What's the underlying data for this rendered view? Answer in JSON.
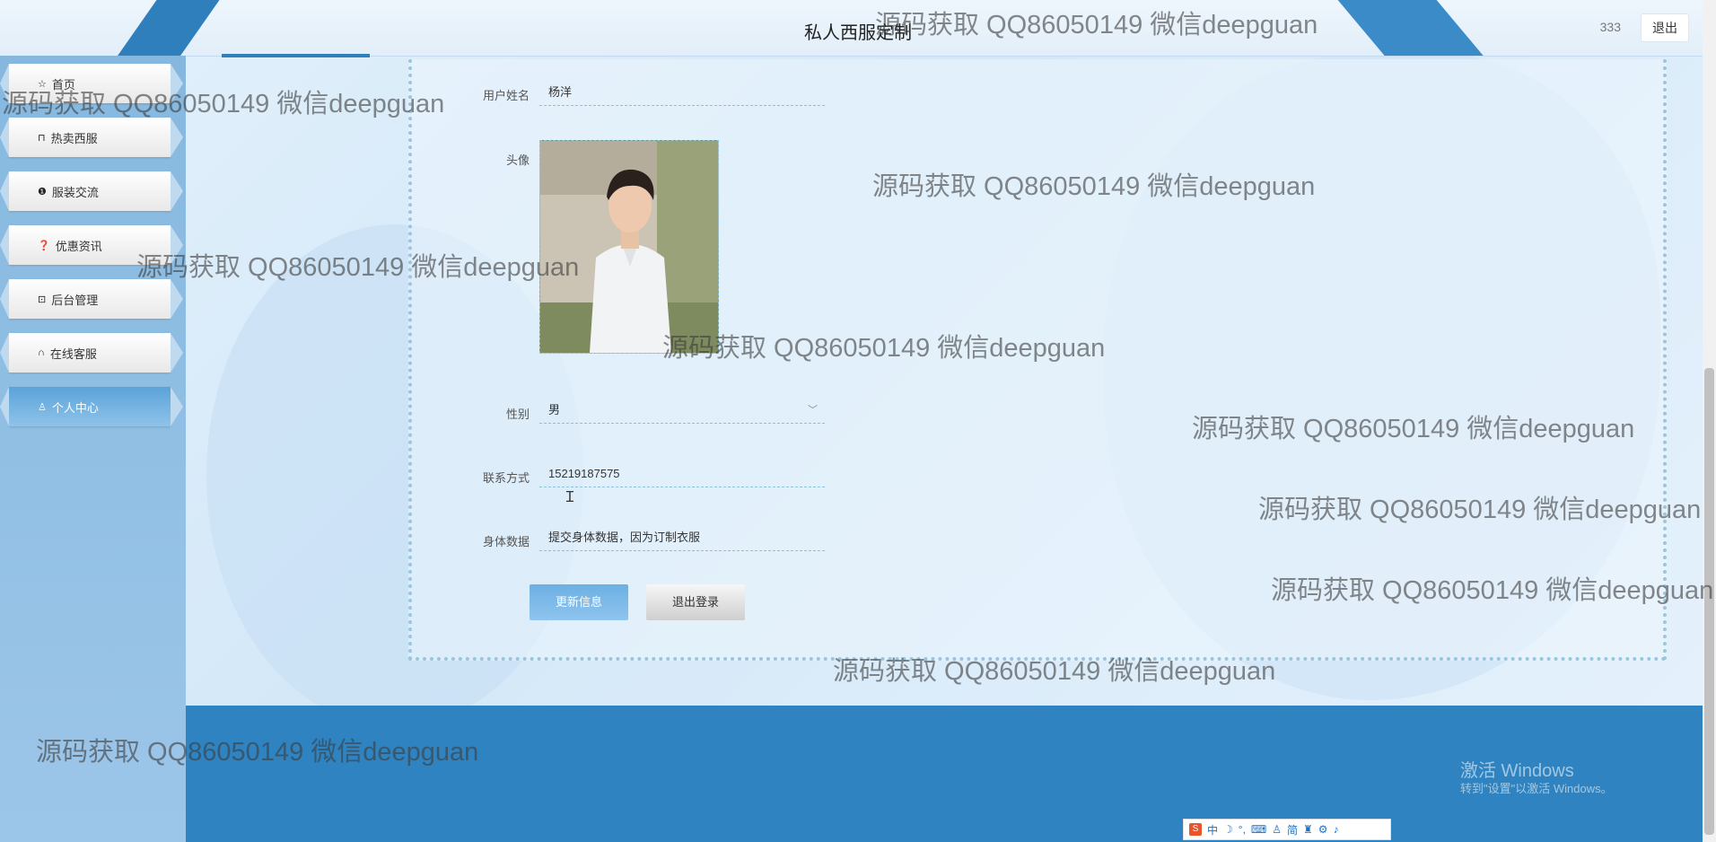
{
  "header": {
    "site_title": "私人西服定制",
    "username": "333",
    "logout_label": "退出"
  },
  "sidebar": {
    "items": [
      {
        "label": "首页",
        "icon": "star-icon"
      },
      {
        "label": "热卖西服",
        "icon": "bag-icon"
      },
      {
        "label": "服装交流",
        "icon": "alert-circle-icon"
      },
      {
        "label": "优惠资讯",
        "icon": "question-circle-icon"
      },
      {
        "label": "后台管理",
        "icon": "briefcase-icon"
      },
      {
        "label": "在线客服",
        "icon": "headset-icon"
      },
      {
        "label": "个人中心",
        "icon": "user-icon",
        "active": true
      }
    ]
  },
  "form": {
    "username_label": "用户姓名",
    "username_value": "杨洋",
    "avatar_label": "头像",
    "gender_label": "性别",
    "gender_value": "男",
    "phone_label": "联系方式",
    "phone_value": "15219187575",
    "body_label": "身体数据",
    "body_value": "提交身体数据，因为订制衣服",
    "update_button": "更新信息",
    "logout_button": "退出登录"
  },
  "watermark_text": "源码获取 QQ86050149 微信deepguan",
  "windows_activation": {
    "title": "激活 Windows",
    "subtitle": "转到\"设置\"以激活 Windows。"
  },
  "ime_toolbar": {
    "items": [
      "中",
      "简"
    ]
  },
  "colors": {
    "accent": "#2f83c0",
    "sidebar": "#8fbfe4",
    "active_nav": "#5aa3d9"
  }
}
